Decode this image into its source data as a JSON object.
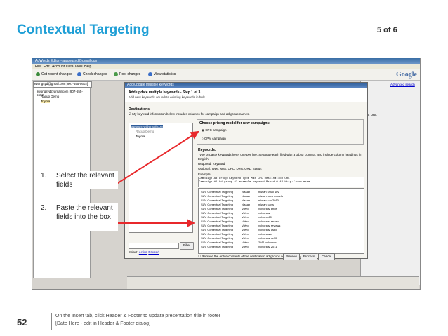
{
  "slide": {
    "title": "Contextual Targeting",
    "page_counter": "5 of 6",
    "slide_number": "52",
    "footer_line1": "On the Insert tab, click Header & Footer to update presentation title in footer",
    "footer_line2": "[Date Here - edit in Header & Footer dialog]",
    "accent_color": "#1f9fd6",
    "arrow_color": "#e8282b"
  },
  "app": {
    "window_title": "AdWords Editor - awongsyd@gmail.com",
    "menu": [
      "File",
      "Edit",
      "Account",
      "Data",
      "Tools",
      "Help"
    ],
    "toolbar": [
      "Get recent changes",
      "Check changes",
      "Post changes",
      "View statistics"
    ],
    "brand": "Google",
    "account_field": "awongsyd@gmail.com [907-655-5602]",
    "tree": [
      "awongsyd@gmail.com [907-655-5602]",
      "Racup Demo",
      "Toyota"
    ],
    "advanced_search": "Advanced search",
    "dest_url_col": "Dest. URL"
  },
  "dialog": {
    "title": "Add/update multiple keywords",
    "step": "Add/update multiple keywords - Step 1 of 3",
    "subtitle": "Add new keywords or update existing keywords in bulk.",
    "destinations_label": "Destinations",
    "destinations_check": "My keyword information below includes columns for campaign and ad group names.",
    "dest_items": [
      "awongsyd@gmail.com",
      "Racup Demo",
      "Toyota"
    ],
    "filter_label": "Filter",
    "select_label": "Select:",
    "select_active": "Active",
    "select_paused": "Paused",
    "pricing_title": "Choose pricing model for new campaigns:",
    "cpc": "CPC campaign",
    "cpm": "CPM campaign",
    "keywords_label": "Keywords:",
    "keywords_help": "Type or paste keywords here, one per line. Separate each field with a tab or comma, and include column headings in English.",
    "required": "Required: Keyword",
    "optional": "Optional: Type, Max. CPC, Dest. URL, Status",
    "example_label": "Example:",
    "example_header": "Campaign    Ad Group    Keyword    Type    Max CPC    Destination URL",
    "example_row": "Campaign #1   Ad group #2   example keyword   Broad   0.44   http://www.exam",
    "keyword_rows": [
      [
        "SUV Contextual Targeting",
        "Nissan",
        "nissan small suv"
      ],
      [
        "SUV Contextual Targeting",
        "Nissan",
        "nissan suvs models"
      ],
      [
        "SUV Contextual Targeting",
        "Nissan",
        "nissan suv 2010"
      ],
      [
        "SUV Contextual Targeting",
        "Nissan",
        "nissan suv s"
      ],
      [
        "SUV Contextual Targeting",
        "Volvo",
        "volvo suv price"
      ],
      [
        "SUV Contextual Targeting",
        "Volvo",
        "volvo suv"
      ],
      [
        "SUV Contextual Targeting",
        "Volvo",
        "volvo xc60"
      ],
      [
        "SUV Contextual Targeting",
        "Volvo",
        "volvo suv review"
      ],
      [
        "SUV Contextual Targeting",
        "Volvo",
        "volvo suv reviews"
      ],
      [
        "SUV Contextual Targeting",
        "Volvo",
        "volvo suv used"
      ],
      [
        "SUV Contextual Targeting",
        "Volvo",
        "volvo suvs"
      ],
      [
        "SUV Contextual Targeting",
        "Volvo",
        "volvo suv xc90"
      ],
      [
        "SUV Contextual Targeting",
        "Volvo",
        "2011 volvo suv"
      ],
      [
        "SUV Contextual Targeting",
        "Volvo",
        "volvo suv 2011"
      ]
    ],
    "replace_label": "Replace the entire contents of the destination ad groups with these keywords.",
    "btn_preview": "Preview",
    "btn_process": "Process",
    "btn_cancel": "Cancel"
  },
  "callouts": [
    {
      "num": "1.",
      "text": "Select the relevant fields"
    },
    {
      "num": "2.",
      "text": "Paste the relevant fields into the box"
    }
  ]
}
